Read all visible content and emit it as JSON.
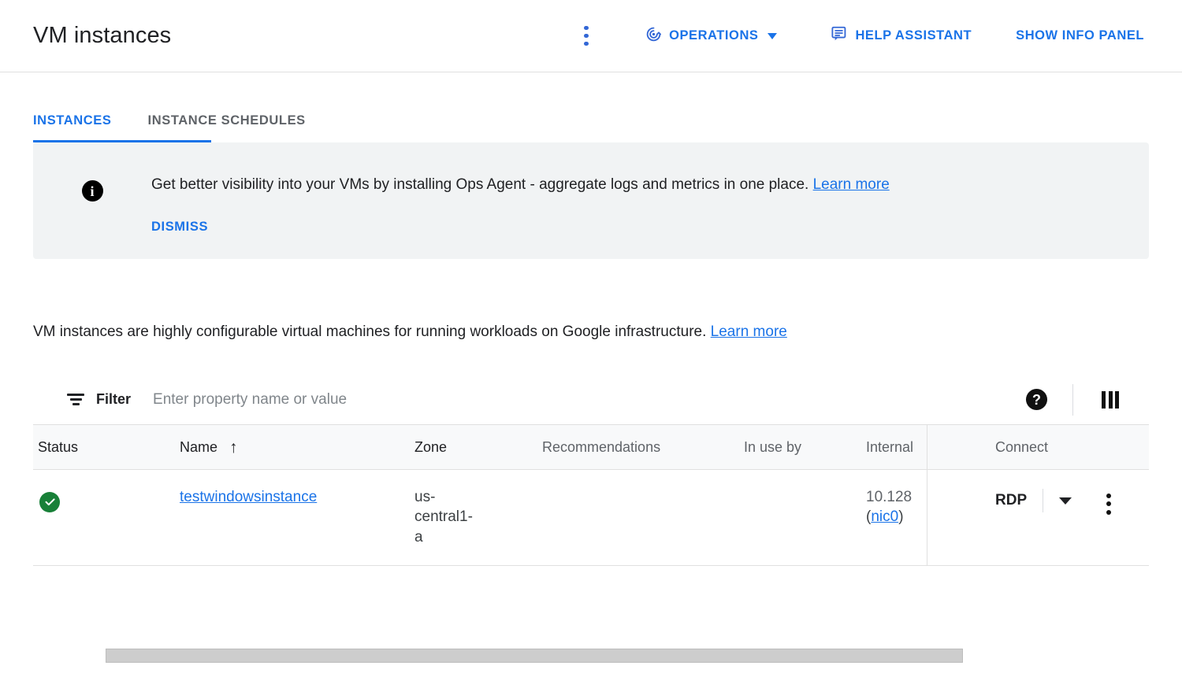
{
  "header": {
    "title": "VM instances",
    "overflow_menu_icon": "kebab-menu-icon",
    "operations_label": "OPERATIONS",
    "operations_icon": "monitoring-target-icon",
    "help_assistant_label": "HELP ASSISTANT",
    "help_assistant_icon": "message-bubble-icon",
    "show_info_panel_label": "SHOW INFO PANEL",
    "accent_color": "#1a73e8"
  },
  "tabs": [
    {
      "label": "INSTANCES",
      "active": true
    },
    {
      "label": "INSTANCE SCHEDULES",
      "active": false
    }
  ],
  "banner": {
    "icon": "info-icon",
    "icon_glyph": "i",
    "text": "Get better visibility into your VMs by installing Ops Agent - aggregate logs and metrics in one place.",
    "learn_more": "Learn more",
    "dismiss_label": "DISMISS",
    "background_color": "#f1f3f4"
  },
  "description": {
    "text": "VM instances are highly configurable virtual machines for running workloads on Google infrastructure.",
    "learn_more": "Learn more"
  },
  "filter": {
    "icon": "filter-icon",
    "label": "Filter",
    "placeholder": "Enter property name or value",
    "value": "",
    "help_icon": "help-question-icon",
    "help_glyph": "?",
    "columns_icon": "column-display-options-icon"
  },
  "table": {
    "columns": [
      {
        "label": "Status",
        "sorted": false,
        "emphasis": "strong"
      },
      {
        "label": "Name",
        "sorted": true,
        "sort_arrow": "↑",
        "emphasis": "strong"
      },
      {
        "label": "Zone",
        "sorted": false,
        "emphasis": "strong"
      },
      {
        "label": "Recommendations",
        "sorted": false,
        "emphasis": "muted"
      },
      {
        "label": "In use by",
        "sorted": false,
        "emphasis": "muted"
      },
      {
        "label": "Internal",
        "sorted": false,
        "emphasis": "muted"
      },
      {
        "label": "Connect",
        "sorted": false,
        "emphasis": "muted"
      }
    ],
    "rows": [
      {
        "status": "running",
        "status_icon": "green-check-circle-icon",
        "name": "testwindowsinstance",
        "zone": "us-central1-a",
        "recommendations": "",
        "in_use_by": "",
        "internal_ip": "10.128",
        "internal_ip_nic_open": "(",
        "internal_ip_nic": "nic0",
        "internal_ip_nic_close": ")",
        "connect_label": "RDP",
        "connect_dropdown_icon": "chevron-down-icon",
        "row_menu_icon": "kebab-menu-icon"
      }
    ]
  },
  "scrollbar": {
    "orientation": "horizontal",
    "thumb_color": "#cdcdcd"
  }
}
